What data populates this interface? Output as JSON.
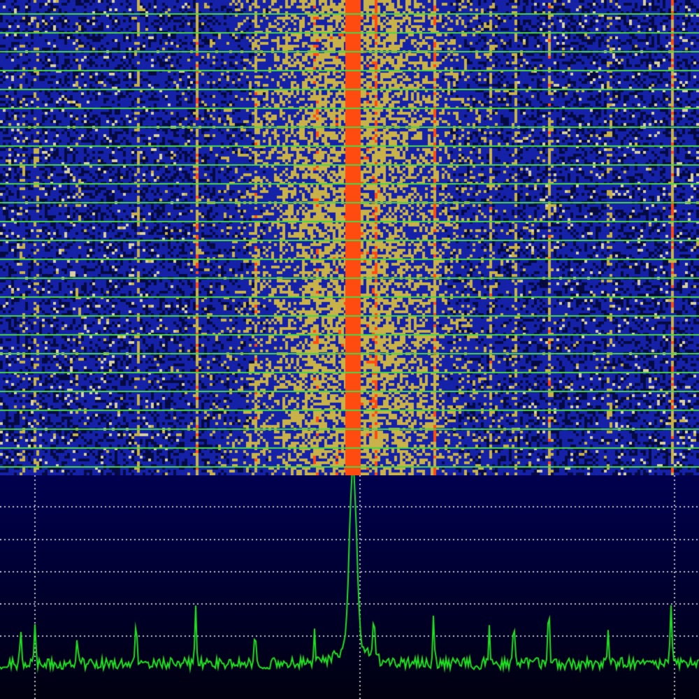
{
  "app": {
    "view": "waterfall-spectrum"
  },
  "colors": {
    "waterfall_low": "#1522a8",
    "waterfall_mid": "#c9b24a",
    "waterfall_high": "#ff4a10",
    "waterfall_line": "#48d848",
    "spectrum_bg_top": "#00004f",
    "spectrum_bg_bottom": "#000010",
    "spectrum_trace": "#22e022",
    "grid": "#ffffff"
  },
  "spectrum": {
    "frequency_bin_count": 200,
    "peaks": [
      {
        "bin": 6,
        "level": 0.18
      },
      {
        "bin": 10,
        "level": 0.22
      },
      {
        "bin": 22,
        "level": 0.12
      },
      {
        "bin": 39,
        "level": 0.22
      },
      {
        "bin": 56,
        "level": 0.28
      },
      {
        "bin": 73,
        "level": 0.2
      },
      {
        "bin": 90,
        "level": 0.15
      },
      {
        "bin": 101,
        "level": 0.95
      },
      {
        "bin": 107,
        "level": 0.22
      },
      {
        "bin": 124,
        "level": 0.22
      },
      {
        "bin": 140,
        "level": 0.18
      },
      {
        "bin": 147,
        "level": 0.22
      },
      {
        "bin": 157,
        "level": 0.3
      },
      {
        "bin": 174,
        "level": 0.2
      },
      {
        "bin": 192,
        "level": 0.32
      }
    ],
    "noise_floor": 0.08
  }
}
